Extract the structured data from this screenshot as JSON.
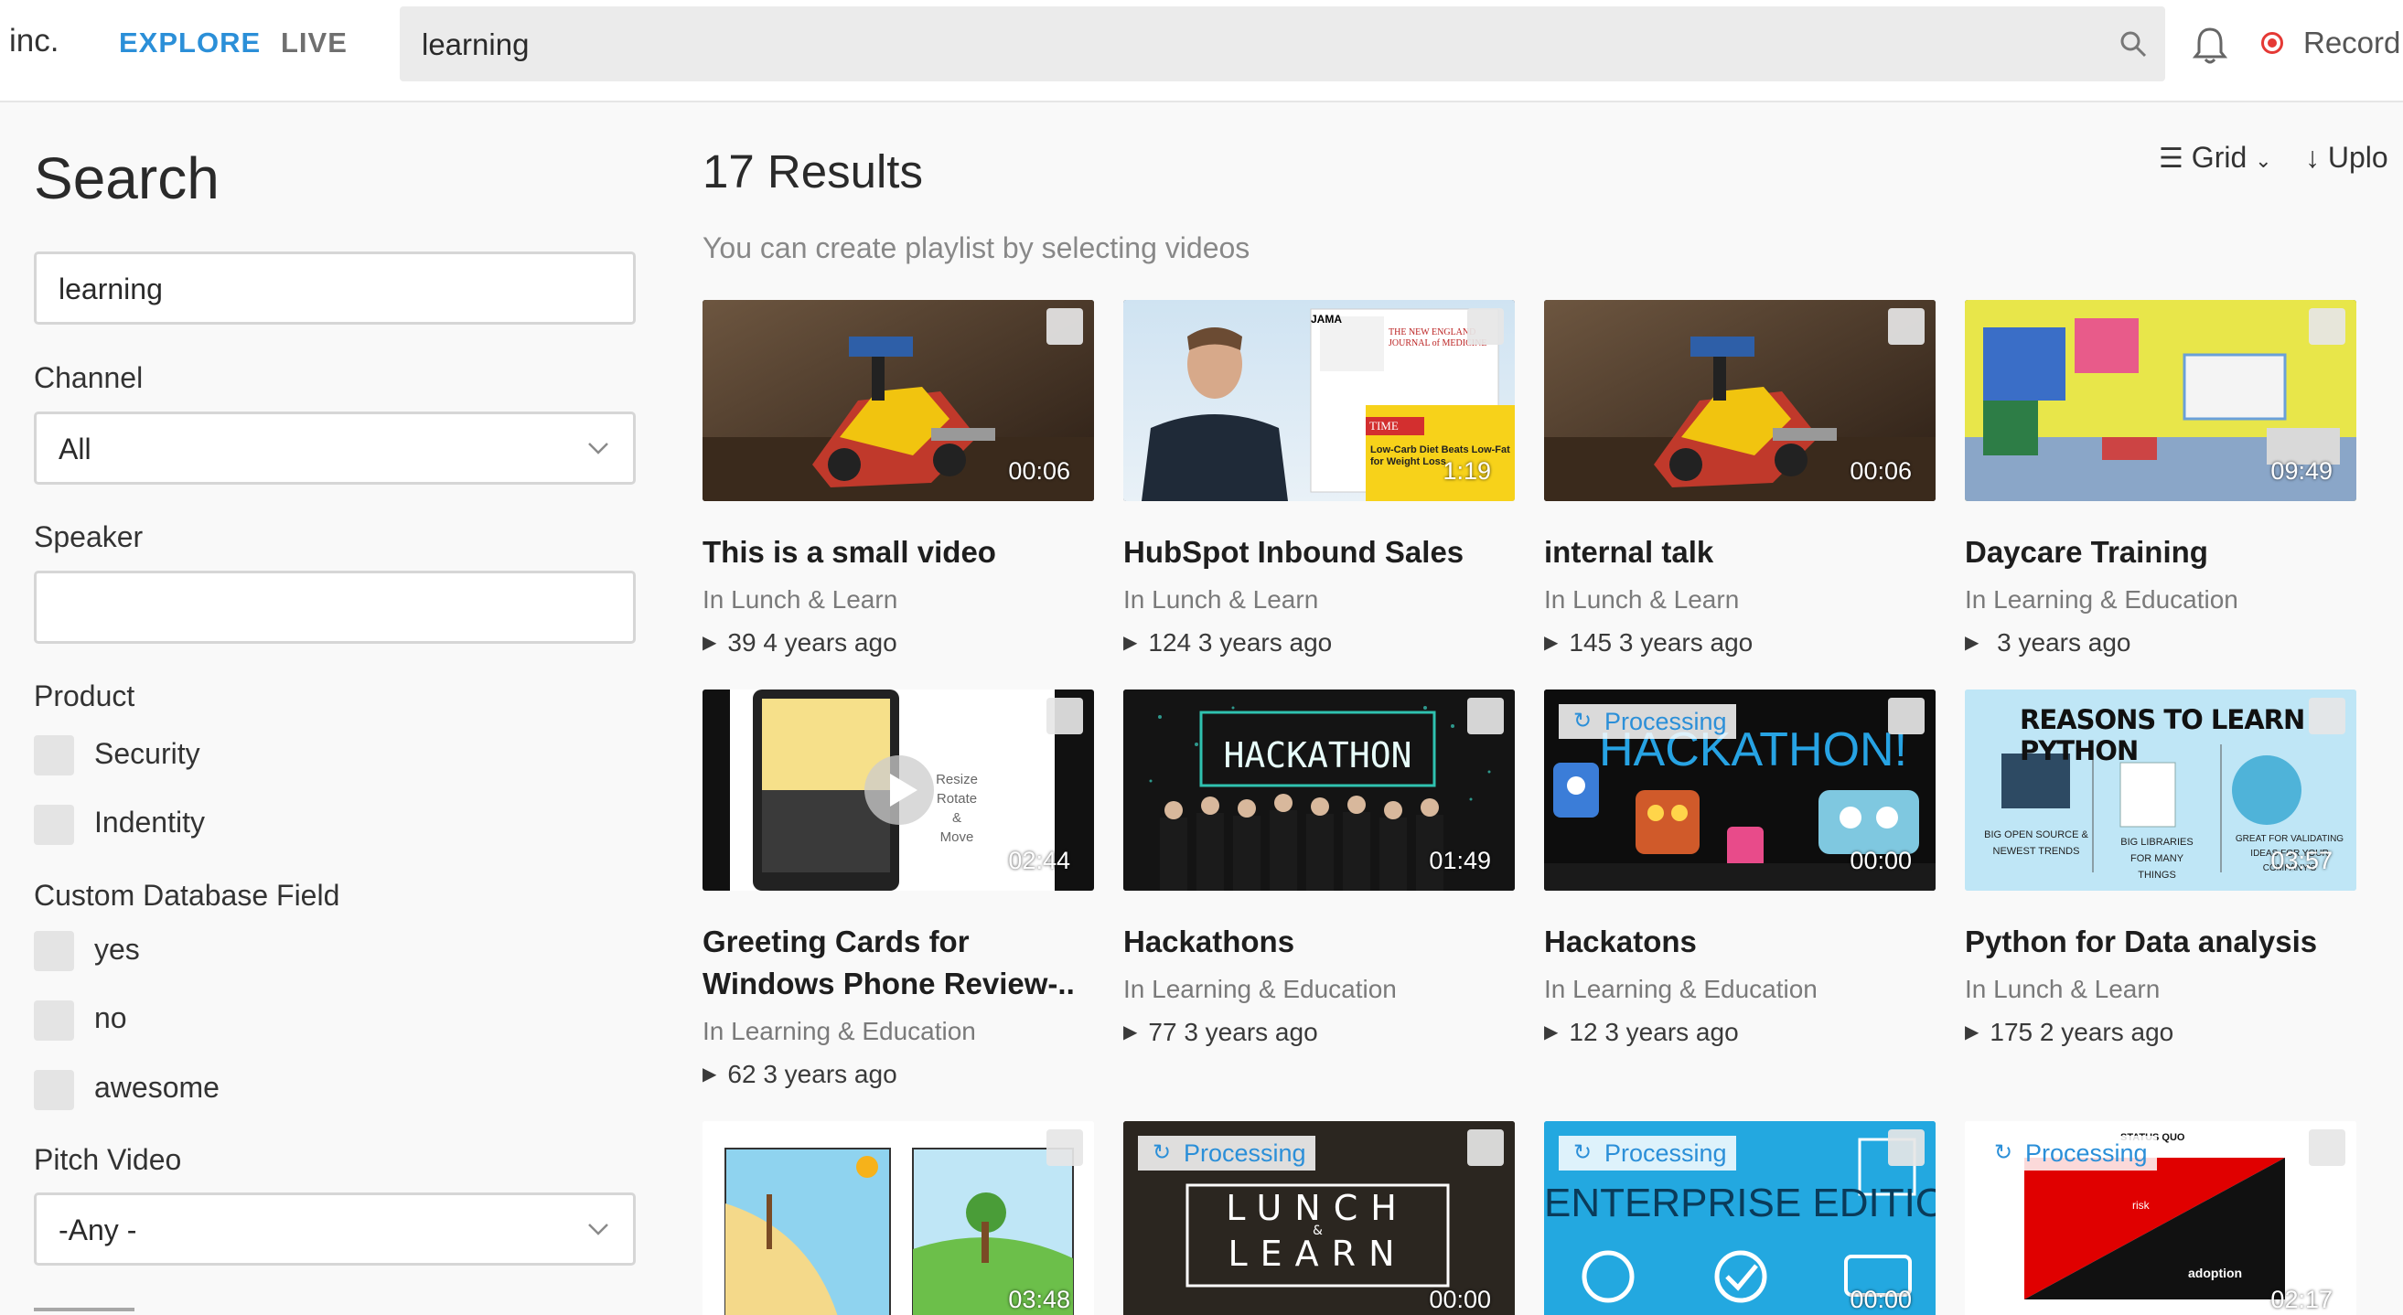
{
  "header": {
    "brand": "inc.",
    "nav": {
      "explore": "EXPLORE",
      "live": "LIVE"
    },
    "search_query": "learning",
    "record_label": "Record"
  },
  "sidebar": {
    "title": "Search",
    "search_value": "learning",
    "channel": {
      "label": "Channel",
      "value": "All"
    },
    "speaker": {
      "label": "Speaker",
      "value": ""
    },
    "product": {
      "label": "Product",
      "options": [
        "Security",
        "Indentity"
      ]
    },
    "custom_field": {
      "label": "Custom Database Field",
      "options": [
        "yes",
        "no",
        "awesome"
      ]
    },
    "pitch_video": {
      "label": "Pitch Video",
      "value": "-Any -"
    }
  },
  "results": {
    "title": "17 Results",
    "hint": "You can create playlist by selecting videos",
    "view_mode": "Grid",
    "upload_label": "Uplo",
    "processing_label": "Processing",
    "videos": [
      {
        "title": "This is a small video",
        "channel": "In Lunch & Learn",
        "views": "39",
        "age": "4 years ago",
        "duration": "00:06"
      },
      {
        "title": "HubSpot Inbound Sales",
        "channel": "In Lunch & Learn",
        "views": "124",
        "age": "3 years ago",
        "duration": "1:19"
      },
      {
        "title": "internal talk",
        "channel": "In Lunch & Learn",
        "views": "145",
        "age": "3 years ago",
        "duration": "00:06"
      },
      {
        "title": "Daycare Training",
        "channel": "In Learning & Education",
        "views": "",
        "age": "3 years ago",
        "duration": "09:49"
      },
      {
        "title": "Greeting Cards for Windows Phone Review-..",
        "channel": "In Learning & Education",
        "views": "62",
        "age": "3 years ago",
        "duration": "02:44"
      },
      {
        "title": "Hackathons",
        "channel": "In Learning & Education",
        "views": "77",
        "age": "3 years ago",
        "duration": "01:49"
      },
      {
        "title": "Hackatons",
        "channel": "In Learning & Education",
        "views": "12",
        "age": "3 years ago",
        "duration": "00:00",
        "processing": true
      },
      {
        "title": "Python for Data analysis",
        "channel": "In Lunch & Learn",
        "views": "175",
        "age": "2 years ago",
        "duration": "03:57"
      },
      {
        "duration": "03:48"
      },
      {
        "duration": "00:00",
        "processing": true
      },
      {
        "duration": "00:00",
        "processing": true
      },
      {
        "duration": "02:17",
        "processing": true
      }
    ]
  },
  "thumbnail_text": {
    "hackathon_sign": "HACKATHON",
    "hackathon_banner": "HACKATHON!",
    "python_title": "REASONS TO LEARN PYTHON",
    "lunch_learn": [
      "LUNCH",
      "&",
      "LEARN"
    ],
    "enterprise": "ENTERPRISE EDITION",
    "card_app": [
      "Resize",
      "Rotate",
      "&",
      "Move"
    ],
    "status_quo": "STATUS QUO",
    "adoption": "adoption",
    "risk": "risk",
    "jama": "JAMA",
    "time": "TIME",
    "nejm": "THE NEW ENGLAND JOURNAL of MEDICINE",
    "lowcarb": "Low-Carb Diet Beats Low-Fat for Weight Loss",
    "python_points": [
      "BIG OPEN SOURCE & NEWEST TRENDS",
      "BIG LIBRARIES FOR MANY THINGS",
      "GREAT FOR VALIDATING IDEAS FOR YOUR COMPANY'S"
    ]
  }
}
